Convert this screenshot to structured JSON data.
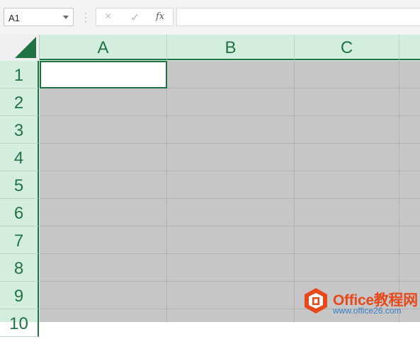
{
  "formula_bar": {
    "name_box": "A1",
    "cancel_icon": "×",
    "enter_icon": "✓",
    "insert_function": "fx",
    "formula_value": ""
  },
  "columns": [
    "A",
    "B",
    "C"
  ],
  "rows": [
    "1",
    "2",
    "3",
    "4",
    "5",
    "6",
    "7",
    "8",
    "9",
    "10"
  ],
  "active_cell": "A1",
  "watermark": {
    "title": "Office教程网",
    "url": "www.office26.com"
  },
  "colors": {
    "accent": "#217346",
    "header_bg": "#d3eddf",
    "cell_gray": "#c6c6c6",
    "watermark_orange": "#e7491b",
    "watermark_blue": "#3b7cc9"
  }
}
